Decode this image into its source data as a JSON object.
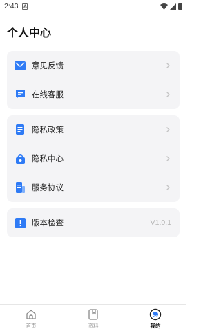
{
  "status_bar": {
    "time": "2:43",
    "notification_icon": "A"
  },
  "page": {
    "title": "个人中心"
  },
  "groups": [
    {
      "items": [
        {
          "label": "意见反馈",
          "icon": "mail-icon"
        },
        {
          "label": "在线客服",
          "icon": "chat-icon"
        }
      ]
    },
    {
      "items": [
        {
          "label": "隐私政策",
          "icon": "privacy-policy-icon"
        },
        {
          "label": "隐私中心",
          "icon": "privacy-center-icon"
        },
        {
          "label": "服务协议",
          "icon": "service-agreement-icon"
        }
      ]
    },
    {
      "items": [
        {
          "label": "版本检查",
          "icon": "version-icon",
          "value": "V1.0.1"
        }
      ]
    }
  ],
  "tabbar": {
    "tabs": [
      {
        "label": "首页",
        "icon": "home-icon",
        "active": false
      },
      {
        "label": "资料",
        "icon": "document-icon",
        "active": false
      },
      {
        "label": "我的",
        "icon": "profile-icon",
        "active": true
      }
    ]
  },
  "colors": {
    "accent": "#2f7bf5",
    "card_background": "#f4f4f6"
  }
}
